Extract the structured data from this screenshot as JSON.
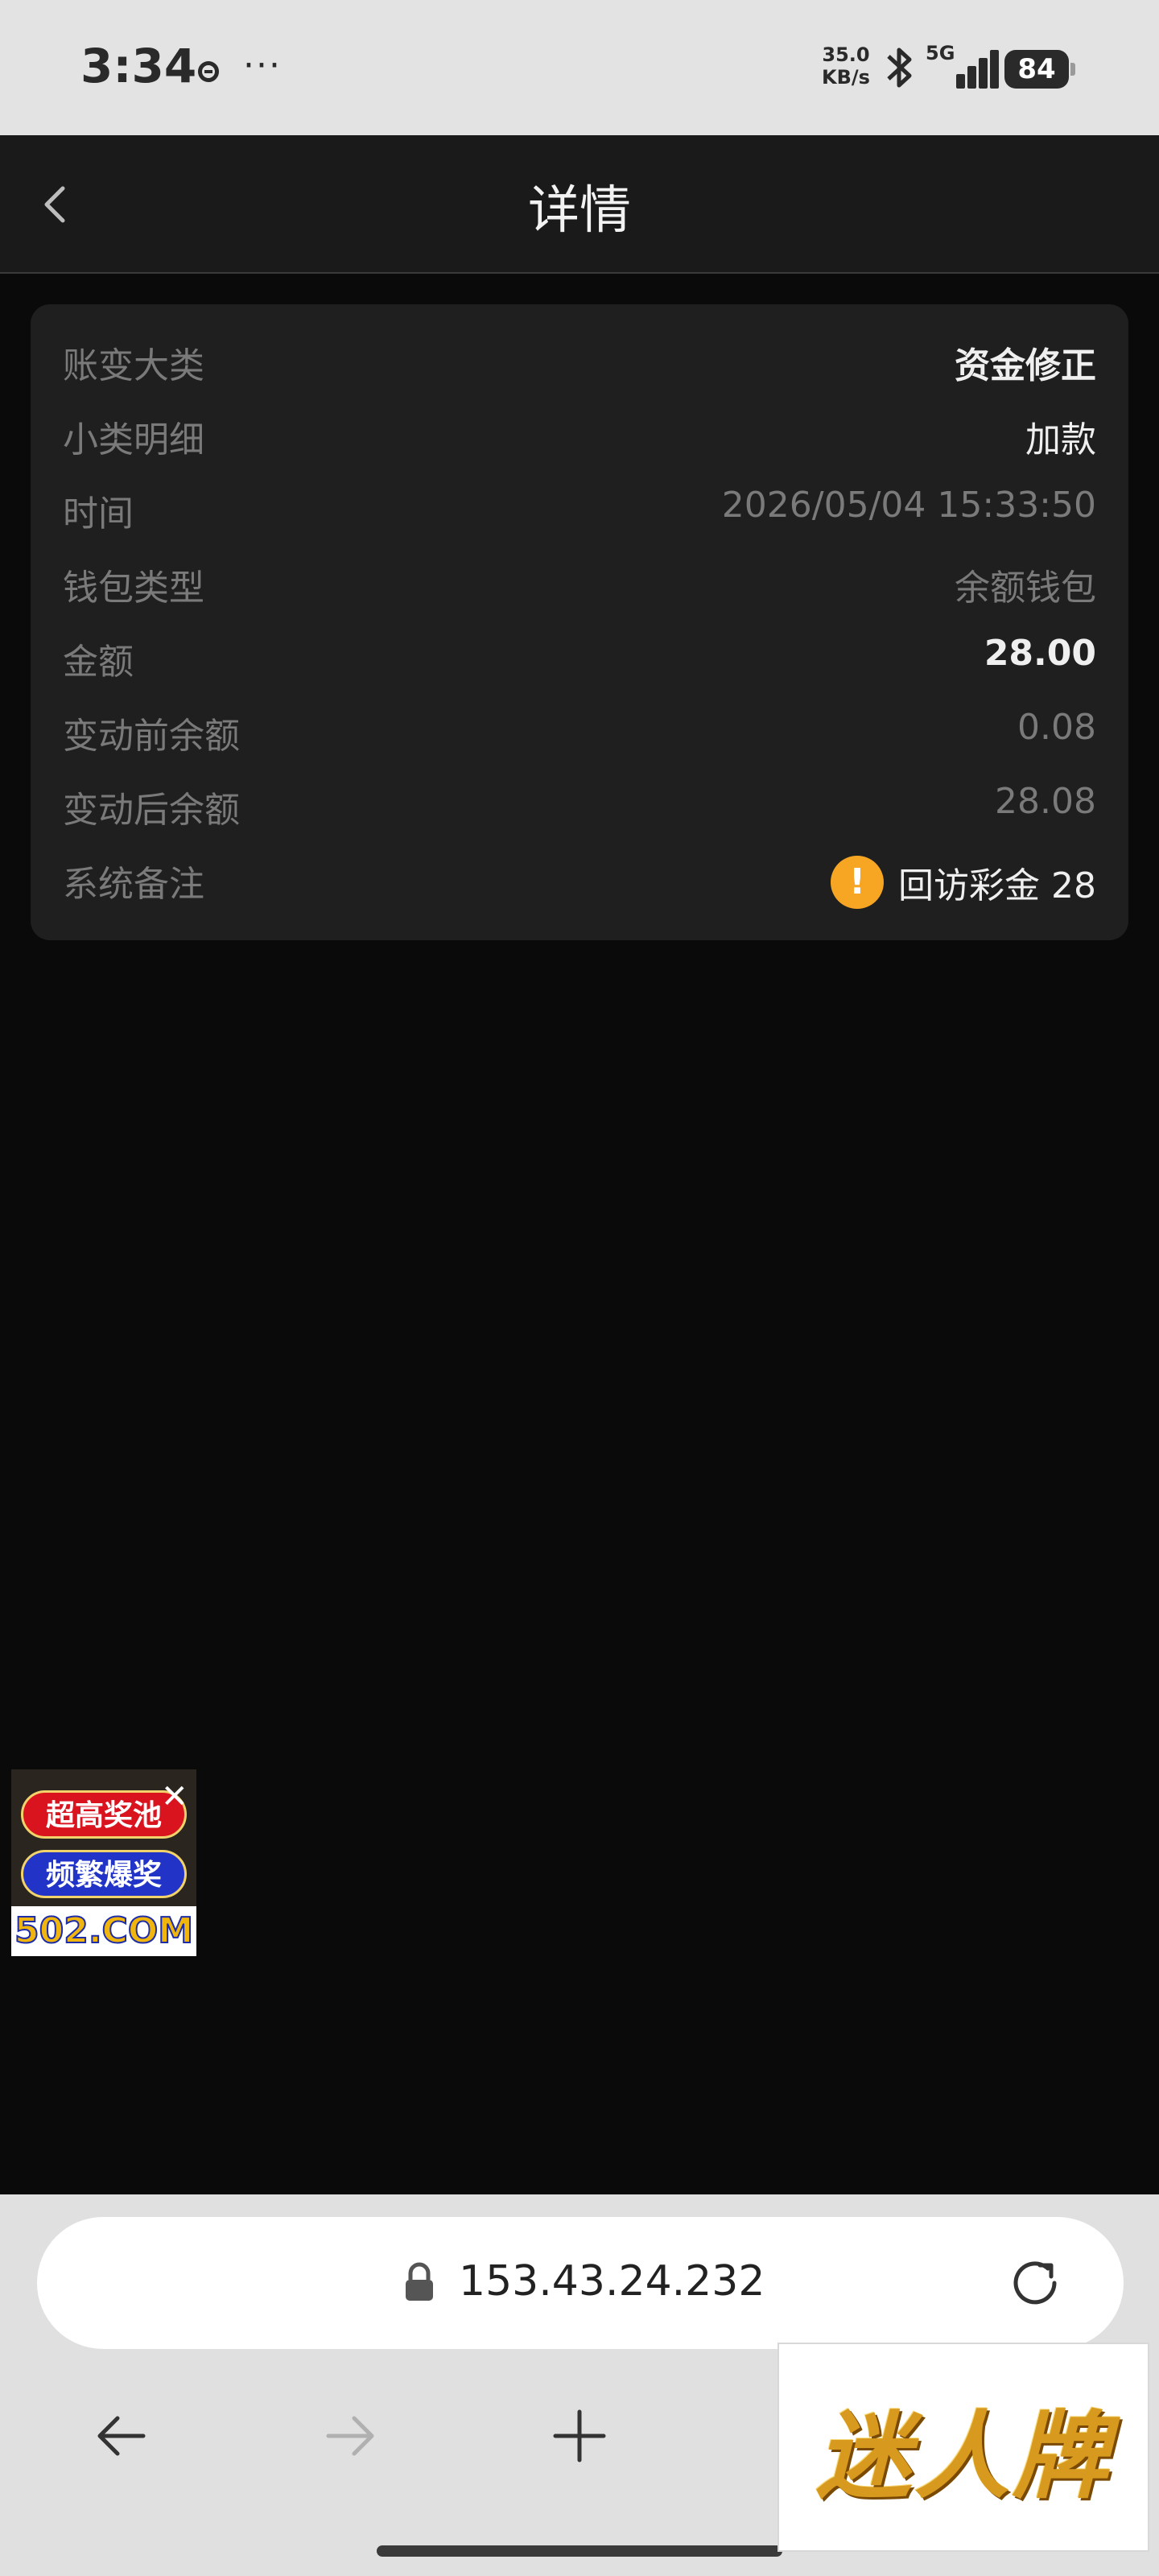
{
  "status_bar": {
    "time": "3:34",
    "more": "···",
    "speed_value": "35.0",
    "speed_unit": "KB/s",
    "network": "5G",
    "battery": "84"
  },
  "header": {
    "title": "详情"
  },
  "details": {
    "rows": [
      {
        "label": "账变大类",
        "value": "资金修正"
      },
      {
        "label": "小类明细",
        "value": "加款"
      },
      {
        "label": "时间",
        "value": "2026/05/04 15:33:50"
      },
      {
        "label": "钱包类型",
        "value": "余额钱包"
      },
      {
        "label": "金额",
        "value": "28.00"
      },
      {
        "label": "变动前余额",
        "value": "0.08"
      },
      {
        "label": "变动后余额",
        "value": "28.08"
      },
      {
        "label": "系统备注",
        "value": "回访彩金 28"
      }
    ],
    "warning_glyph": "!"
  },
  "float_ad": {
    "line1": "超高奖池",
    "line2": "频繁爆奖",
    "domain": "502.COM",
    "close": "✕"
  },
  "browser": {
    "url": "153.43.24.232"
  },
  "brand_overlay": {
    "text": "迷人牌"
  },
  "colors": {
    "background": "#0a0a0a",
    "card": "#1f1f1f",
    "warning": "#f6a623"
  }
}
